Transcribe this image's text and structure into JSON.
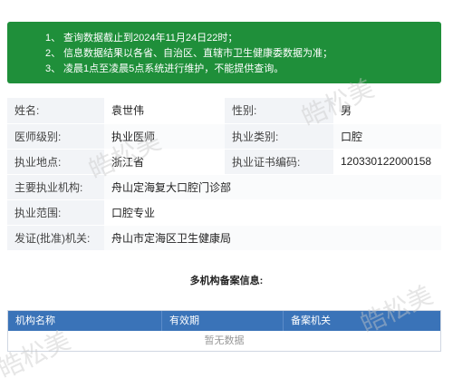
{
  "notice": {
    "items": [
      {
        "num": "1、",
        "text": "查询数据截止到2024年11月24日22时；"
      },
      {
        "num": "2、",
        "text": "信息数据结果以各省、自治区、直辖市卫生健康委数据为准；"
      },
      {
        "num": "3、",
        "text": "凌晨1点至凌晨5点系统进行维护，不能提供查询。"
      }
    ]
  },
  "info": {
    "name_label": "姓名:",
    "name_value": "袁世伟",
    "gender_label": "性别:",
    "gender_value": "男",
    "level_label": "医师级别:",
    "level_value": "执业医师",
    "category_label": "执业类别:",
    "category_value": "口腔",
    "location_label": "执业地点:",
    "location_value": "浙江省",
    "cert_label": "执业证书编码:",
    "cert_value": "120330122000158",
    "org_label": "主要执业机构:",
    "org_value": "舟山定海复大口腔门诊部",
    "scope_label": "执业范围:",
    "scope_value": "口腔专业",
    "issuer_label": "发证(批准)机关:",
    "issuer_value": "舟山市定海区卫生健康局"
  },
  "multi": {
    "title": "多机构备案信息:",
    "columns": [
      "机构名称",
      "有效期",
      "备案机关"
    ],
    "empty_text": "暂无数据"
  },
  "watermark": {
    "text": "皓松美"
  }
}
